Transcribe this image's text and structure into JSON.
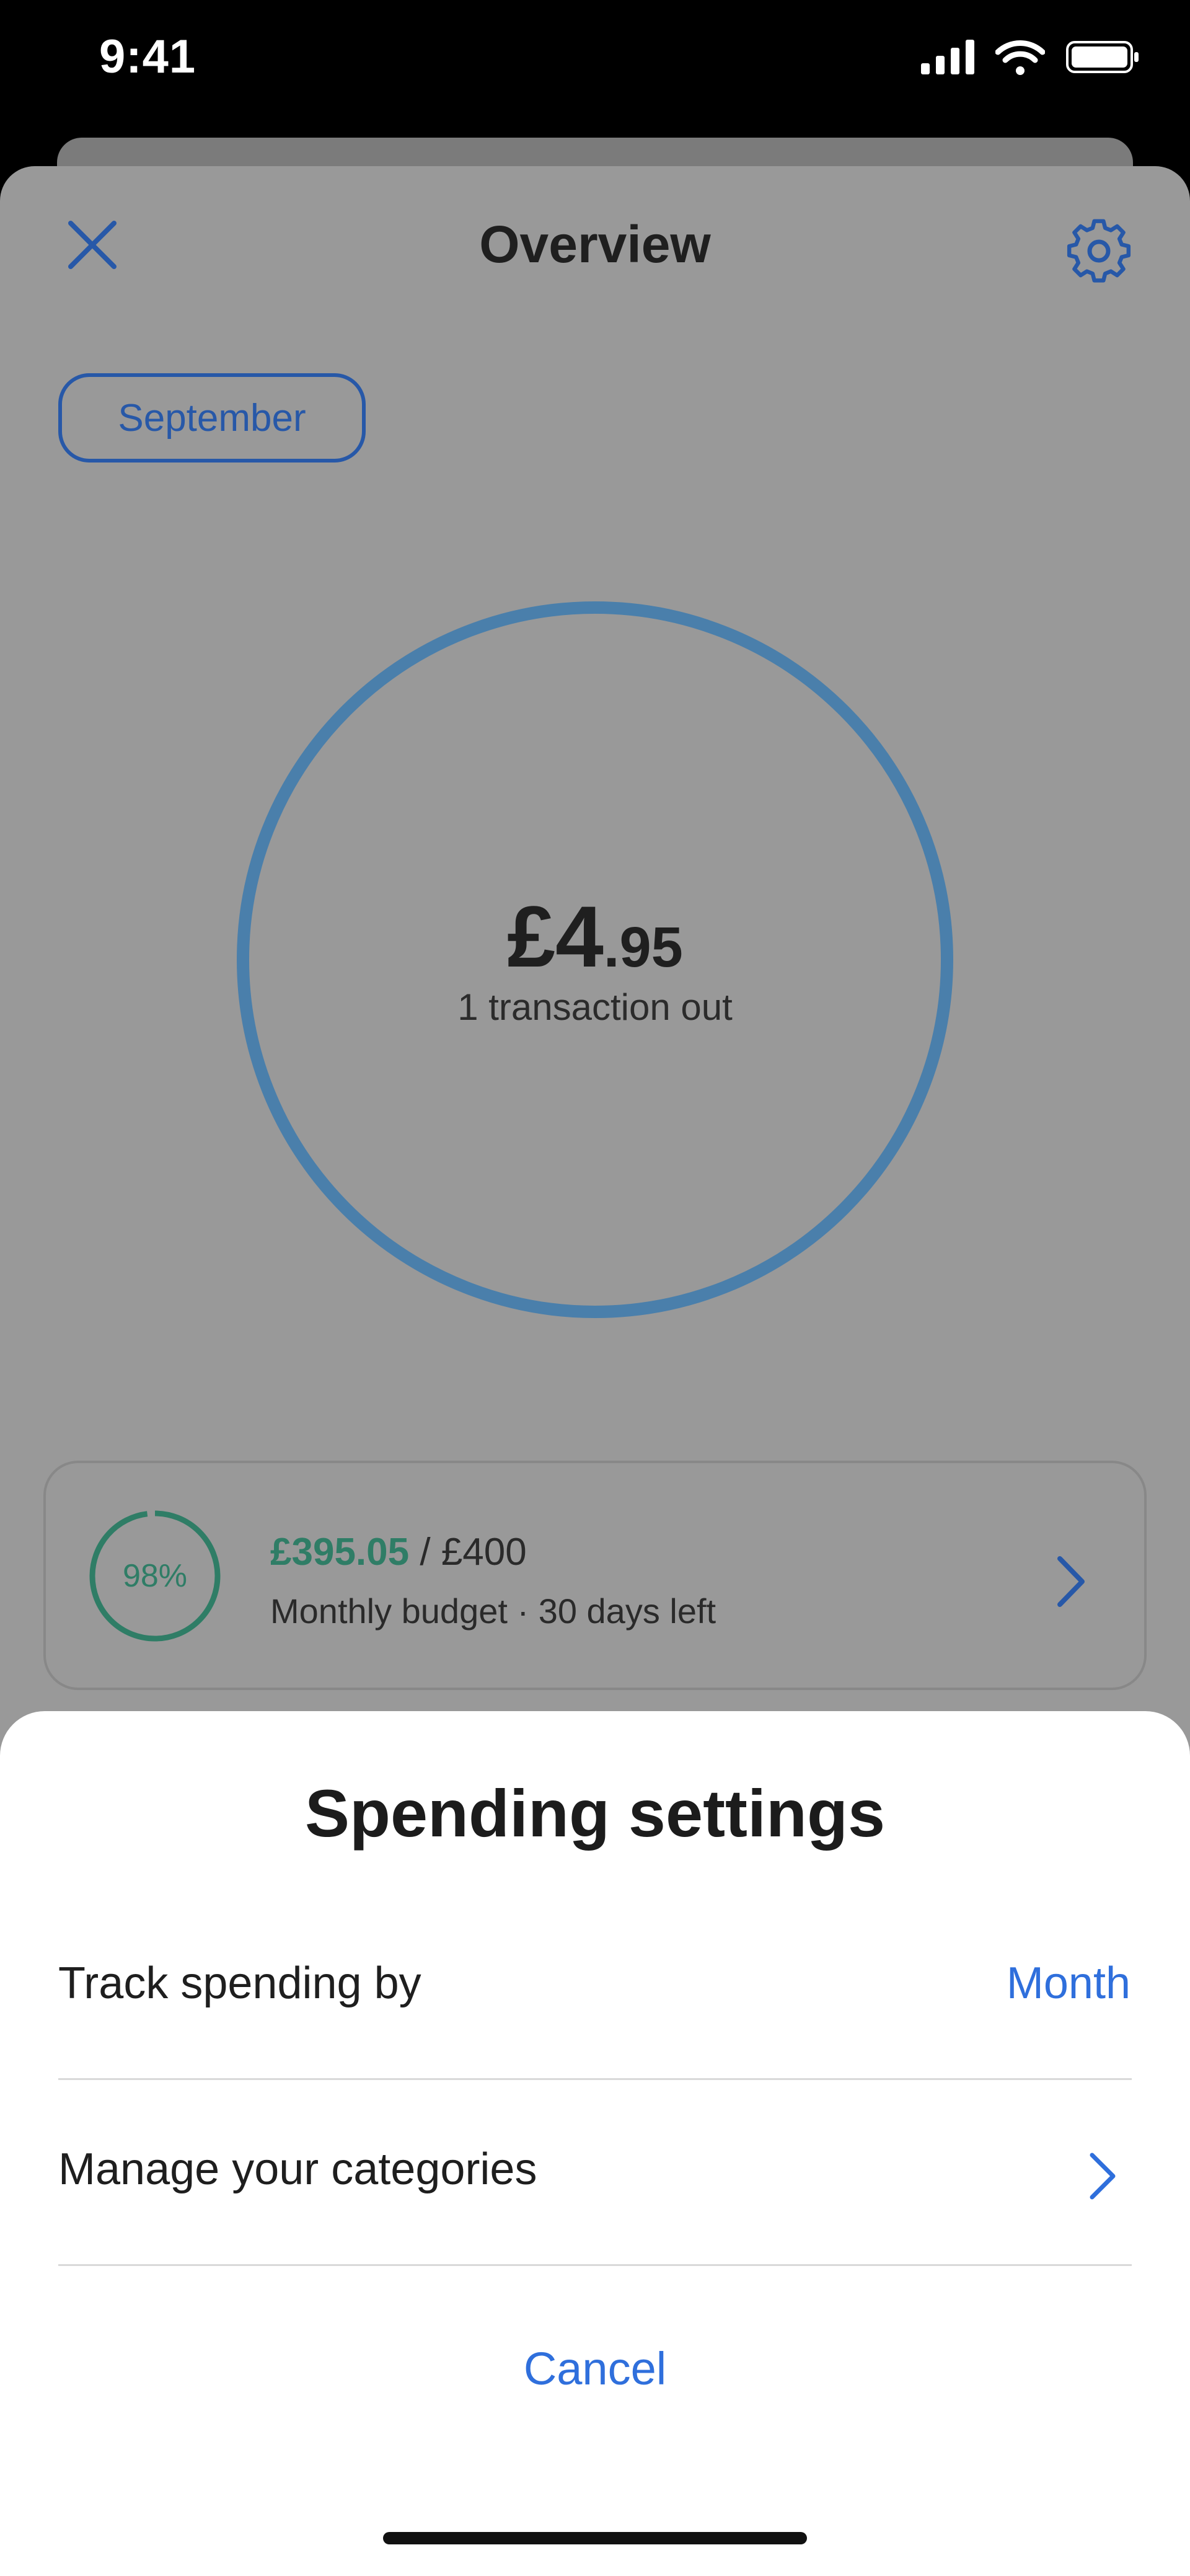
{
  "status_bar": {
    "time": "9:41"
  },
  "header": {
    "title": "Overview",
    "close_icon": "close-icon",
    "settings_icon": "gear-icon"
  },
  "period": {
    "label": "September"
  },
  "summary": {
    "amount_major": "£4",
    "amount_minor": ".95",
    "transactions": "1 transaction out",
    "ring_color": "#4a7fab"
  },
  "budget": {
    "percent_label": "98%",
    "percent_value": 0.98,
    "spent": "£395.05",
    "separator": " / ",
    "total": "£400",
    "subtitle": "Monthly budget · 30 days left",
    "color": "#2f7d66"
  },
  "settings_sheet": {
    "title": "Spending settings",
    "track_label": "Track spending by",
    "track_value": "Month",
    "categories_label": "Manage your categories",
    "cancel_label": "Cancel",
    "accent": "#2f6fdc"
  },
  "colors": {
    "brand_blue": "#2758a8",
    "overlay": "#999999"
  }
}
